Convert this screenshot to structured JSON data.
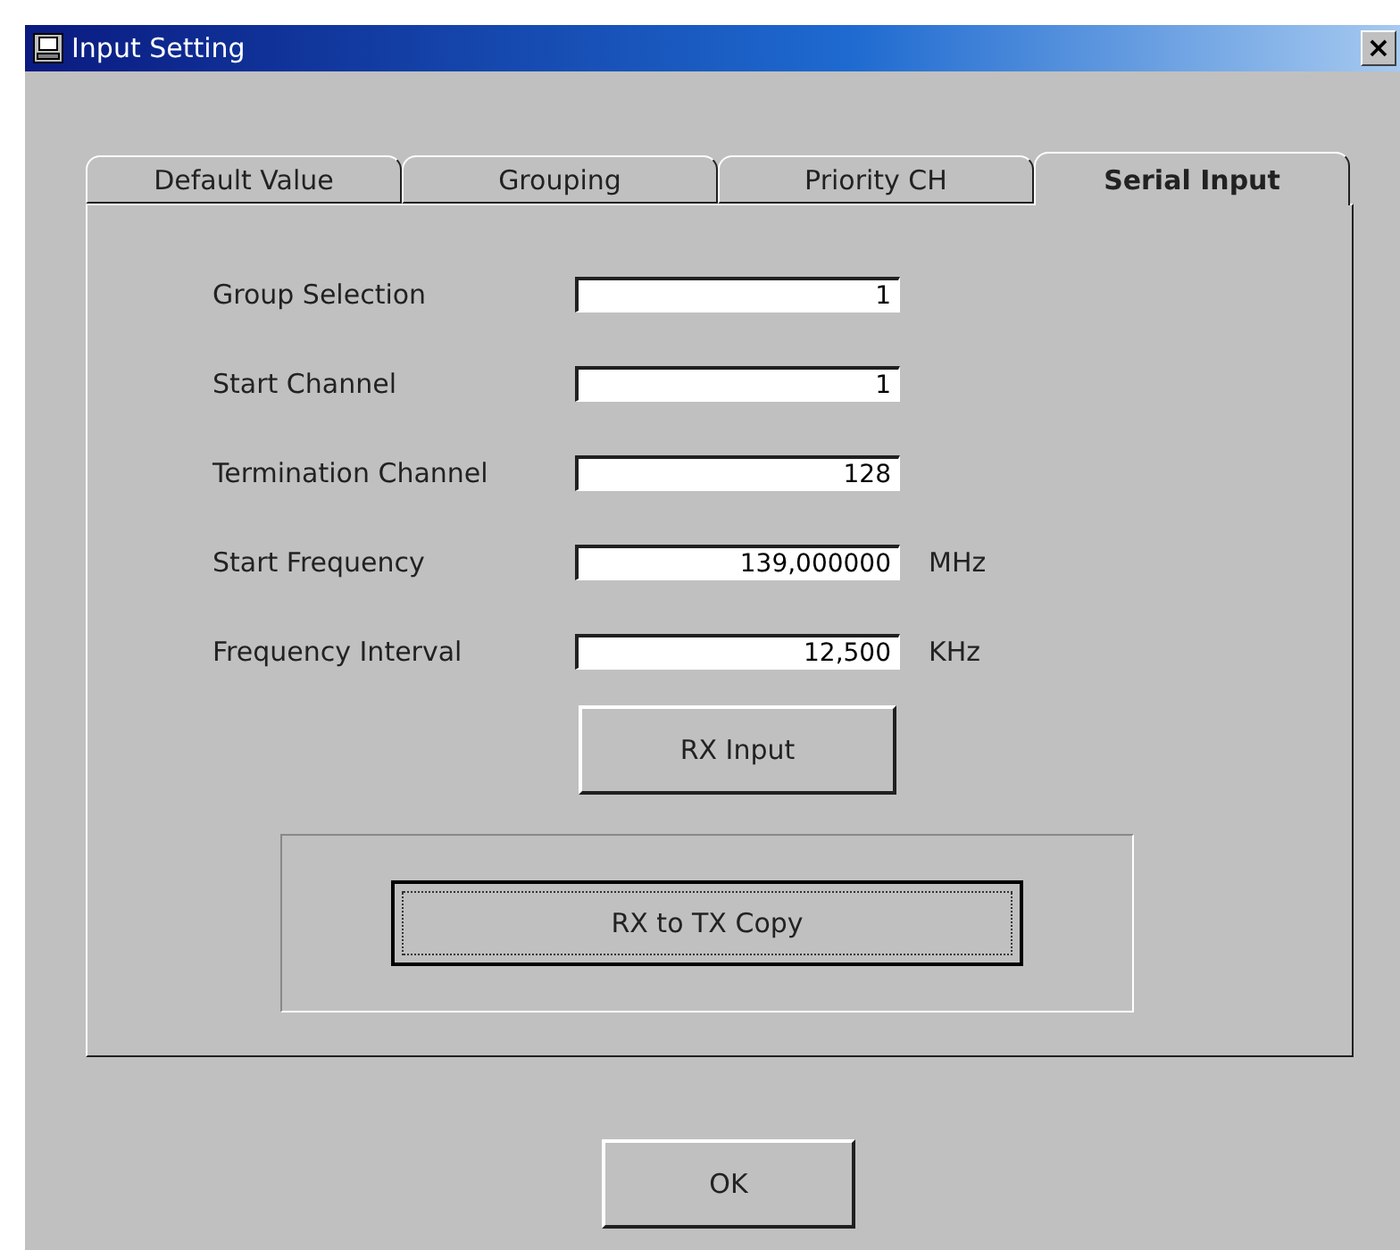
{
  "window": {
    "title": "Input Setting",
    "close": "×"
  },
  "tabs": [
    {
      "label": "Default Value",
      "selected": false
    },
    {
      "label": "Grouping",
      "selected": false
    },
    {
      "label": "Priority CH",
      "selected": false
    },
    {
      "label": "Serial Input",
      "selected": true
    }
  ],
  "fields": [
    {
      "label": "Group Selection",
      "value": "1"
    },
    {
      "label": "Start Channel",
      "value": "1"
    },
    {
      "label": "Termination Channel",
      "value": "128"
    },
    {
      "label": "Start Frequency",
      "value": "139,000000",
      "unit": "MHz"
    },
    {
      "label": "Frequency Interval",
      "value": "12,500",
      "unit": "KHz"
    }
  ],
  "rx_input_button": "RX Input",
  "copy_button": {
    "label": "RX to TX Copy",
    "focused": true
  },
  "ok_button": "OK"
}
